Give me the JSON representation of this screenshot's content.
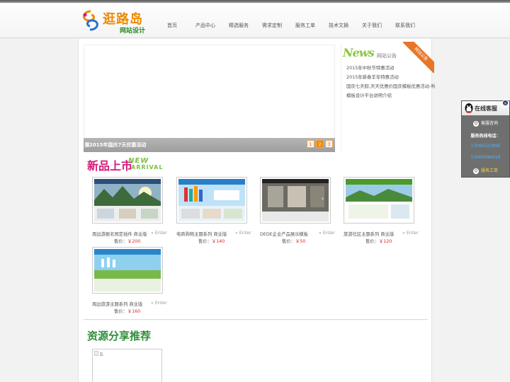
{
  "header": {
    "logo_main": "逛路岛",
    "logo_sub": "网站设计",
    "nav": [
      "首页",
      "产品中心",
      "精选服务",
      "需求定制",
      "服务工单",
      "技术文摘",
      "关于我们",
      "联系我们"
    ]
  },
  "banner": {
    "caption": "2015年国庆7天优惠活动",
    "pages": [
      "1",
      "2",
      "3"
    ],
    "active_page": 2
  },
  "news": {
    "title": "News",
    "subtitle": "网站公告",
    "ribbon": "网站公告",
    "items": [
      "2015年中秋节特惠活动",
      "2015年新春羊年特惠活动",
      "国庆七天假,天天优惠价国庆模板优惠活动-听",
      "模板设计平台说明介绍"
    ]
  },
  "new_arrival": {
    "cn": "新品上市",
    "en1": "NEW",
    "en2": "ARRIVAL"
  },
  "products": [
    {
      "name": "周边游报名预定插件 商业版",
      "enter": "Enter",
      "price_label": "售价：",
      "price": "￥200"
    },
    {
      "name": "电商购物主题系列 商业版",
      "enter": "Enter",
      "price_label": "售价：",
      "price": "￥140"
    },
    {
      "name": "DEDE企业产品展示模板",
      "enter": "Enter",
      "price_label": "售价：",
      "price": "￥50"
    },
    {
      "name": "旅游社区主题系列 商业版",
      "enter": "Enter",
      "price_label": "售价：",
      "price": "￥120"
    },
    {
      "name": "周边旅游主题系列 商业版",
      "enter": "Enter",
      "price_label": "售价：",
      "price": "￥160"
    }
  ],
  "resources": {
    "title": "资源分享推荐",
    "alt": "五"
  },
  "customer_service": {
    "title": "在线客服",
    "close": "×",
    "consult": "客服咨询",
    "hotline_label": "服务热线电话：",
    "phones": [
      "17095523995",
      "13064596416"
    ],
    "ticket": "服务工单"
  },
  "colors": {
    "accent_orange": "#f08a00",
    "price_red": "#dd2222",
    "green": "#2f8f3a",
    "magenta": "#d61a7a"
  }
}
